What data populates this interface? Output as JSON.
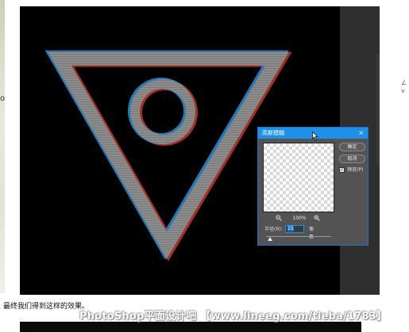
{
  "dialog": {
    "title": "高斯模糊",
    "close_glyph": "×",
    "ok_label": "确定",
    "cancel_label": "取消",
    "preview_checked": true,
    "preview_check_glyph": "✓",
    "preview_label": "预览(P)",
    "zoom_out_icon": "zoom-out-icon",
    "zoom_in_icon": "zoom-in-icon",
    "zoom_value": "100%",
    "radius_label": "半径(R):",
    "radius_value": "15",
    "radius_unit": "像素",
    "accent_color": "#1e90e8"
  },
  "article": {
    "caption": "最终我们得到这样的效果。",
    "watermark": "PhotoShop平面设计吧 【www.lineeg.com/tieba/1783】"
  },
  "colors": {
    "canvas_bg": "#000000",
    "shape_gray": "#8a8a8a",
    "panel_bg": "#535353",
    "titlebar": "#1e90e8"
  }
}
